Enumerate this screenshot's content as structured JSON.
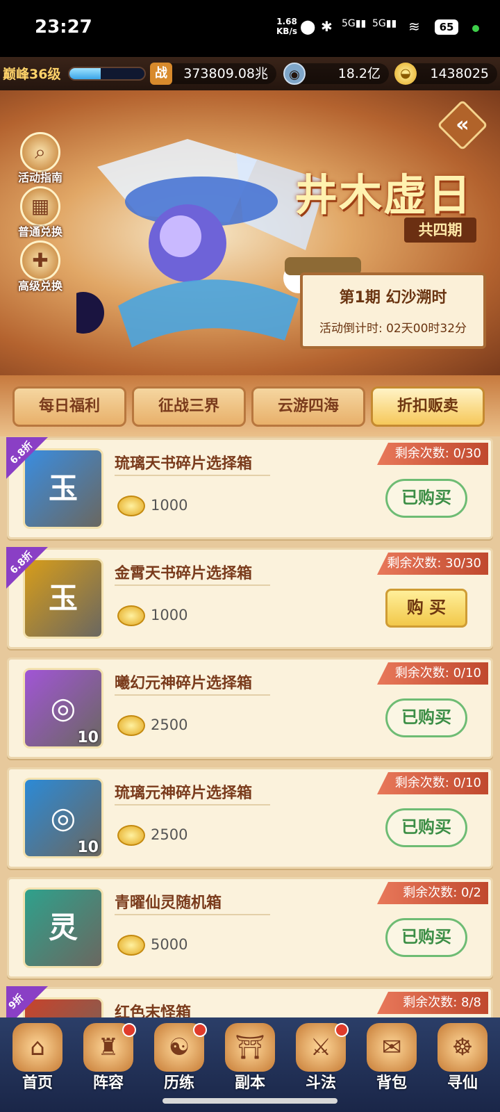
{
  "status_bar": {
    "time": "23:27",
    "speed_value": "1.68",
    "speed_unit": "KB/s",
    "network_1": "5G",
    "network_2": "5G",
    "battery": "65"
  },
  "top_bar": {
    "level": "巅峰36级",
    "xp_progress": 0.42,
    "power": "373809.08兆",
    "copper": "18.2亿",
    "gold": "1438025",
    "power_icon": "战"
  },
  "banner": {
    "title": "井木虚日",
    "subtitle": "共四期",
    "period": "第1期  幻沙溯时",
    "countdown": "活动倒计时: 02天00时32分",
    "side_buttons": [
      {
        "label": "活动指南",
        "icon": "search-icon"
      },
      {
        "label": "普通兑换",
        "icon": "shop-icon"
      },
      {
        "label": "高级兑换",
        "icon": "gift-icon"
      }
    ]
  },
  "tabs": [
    {
      "label": "每日福利"
    },
    {
      "label": "征战三界"
    },
    {
      "label": "云游四海"
    },
    {
      "label": "折扣贩卖",
      "active": true
    }
  ],
  "items": [
    {
      "name": "琉璃天书碎片选择箱",
      "price": "1000",
      "remaining": "剩余次数: 0/30",
      "button": "已购买",
      "state": "done",
      "discount": "6.8折",
      "thumb_color": "#3a8de0",
      "glyph": "玉",
      "count": ""
    },
    {
      "name": "金霄天书碎片选择箱",
      "price": "1000",
      "remaining": "剩余次数: 30/30",
      "button": "购 买",
      "state": "buy",
      "discount": "6.8折",
      "thumb_color": "#d79d1a",
      "glyph": "玉",
      "count": ""
    },
    {
      "name": "曦幻元神碎片选择箱",
      "price": "2500",
      "remaining": "剩余次数: 0/10",
      "button": "已购买",
      "state": "done",
      "discount": "",
      "thumb_color": "#a155d6",
      "glyph": "◎",
      "count": "10"
    },
    {
      "name": "琉璃元神碎片选择箱",
      "price": "2500",
      "remaining": "剩余次数: 0/10",
      "button": "已购买",
      "state": "done",
      "discount": "",
      "thumb_color": "#2c8ad6",
      "glyph": "◎",
      "count": "10"
    },
    {
      "name": "青曜仙灵随机箱",
      "price": "5000",
      "remaining": "剩余次数: 0/2",
      "button": "已购买",
      "state": "done",
      "discount": "",
      "thumb_color": "#2fa18c",
      "glyph": "灵",
      "count": ""
    },
    {
      "name": "红色末怪箱",
      "price": "",
      "remaining": "剩余次数: 8/8",
      "button": "",
      "state": "partial",
      "discount": "9折",
      "thumb_color": "#c8432b",
      "glyph": "",
      "count": ""
    }
  ],
  "nav": [
    {
      "label": "首页",
      "icon": "home-icon",
      "dot": false
    },
    {
      "label": "阵容",
      "icon": "lineup-icon",
      "dot": true
    },
    {
      "label": "历练",
      "icon": "training-icon",
      "dot": true
    },
    {
      "label": "副本",
      "icon": "dungeon-icon",
      "dot": false
    },
    {
      "label": "斗法",
      "icon": "battle-icon",
      "dot": true
    },
    {
      "label": "背包",
      "icon": "bag-icon",
      "dot": false
    },
    {
      "label": "寻仙",
      "icon": "seek-icon",
      "dot": false
    }
  ]
}
